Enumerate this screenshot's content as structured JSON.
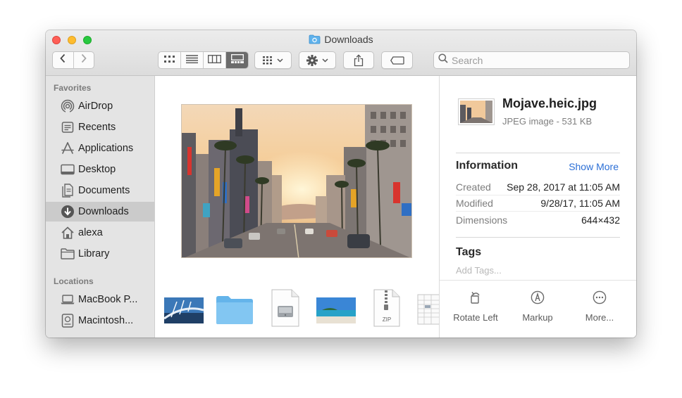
{
  "window": {
    "title": "Downloads",
    "title_icon": "folder-icon"
  },
  "toolbar": {
    "back_icon": "chevron-left-icon",
    "forward_icon": "chevron-right-icon",
    "view_modes": [
      "icon-view-icon",
      "list-view-icon",
      "column-view-icon",
      "gallery-view-icon"
    ],
    "active_view": "gallery-view-icon",
    "group_icon": "group-by-icon",
    "action_icon": "gear-icon",
    "share_icon": "share-icon",
    "tag_icon": "tag-icon",
    "search_placeholder": "Search"
  },
  "sidebar": {
    "favorites_header": "Favorites",
    "favorites": [
      {
        "label": "AirDrop",
        "icon": "airdrop-icon"
      },
      {
        "label": "Recents",
        "icon": "recents-icon"
      },
      {
        "label": "Applications",
        "icon": "applications-icon"
      },
      {
        "label": "Desktop",
        "icon": "desktop-icon"
      },
      {
        "label": "Documents",
        "icon": "documents-icon"
      },
      {
        "label": "Downloads",
        "icon": "downloads-icon",
        "selected": true
      },
      {
        "label": "alexa",
        "icon": "home-icon"
      },
      {
        "label": "Library",
        "icon": "folder-icon"
      }
    ],
    "locations_header": "Locations",
    "locations": [
      {
        "label": "MacBook P...",
        "icon": "laptop-icon"
      },
      {
        "label": "Macintosh...",
        "icon": "hard-drive-icon"
      }
    ]
  },
  "gallery": {
    "thumbnails": [
      "bridge-image",
      "folder",
      "disk-image-file",
      "beach-image",
      "zip-archive",
      "spreadsheet-file"
    ],
    "zip_label": "ZIP"
  },
  "inspector": {
    "file_name": "Mojave.heic.jpg",
    "file_type": "JPEG image - 531 KB",
    "information_title": "Information",
    "show_more": "Show More",
    "rows": [
      {
        "key": "Created",
        "value": "Sep 28, 2017 at 11:05 AM"
      },
      {
        "key": "Modified",
        "value": "9/28/17, 11:05 AM"
      },
      {
        "key": "Dimensions",
        "value": "644×432"
      }
    ],
    "tags_title": "Tags",
    "tags_placeholder": "Add Tags...",
    "actions": [
      {
        "label": "Rotate Left",
        "icon": "rotate-left-icon"
      },
      {
        "label": "Markup",
        "icon": "markup-icon"
      },
      {
        "label": "More...",
        "icon": "more-icon"
      }
    ]
  },
  "colors": {
    "accent": "#2c6fd6",
    "close": "#fe5f57",
    "minimize": "#febc2e",
    "maximize": "#28c840",
    "sidebar_bg": "#e4e4e4",
    "sidebar_selected": "#cbcbcb"
  }
}
